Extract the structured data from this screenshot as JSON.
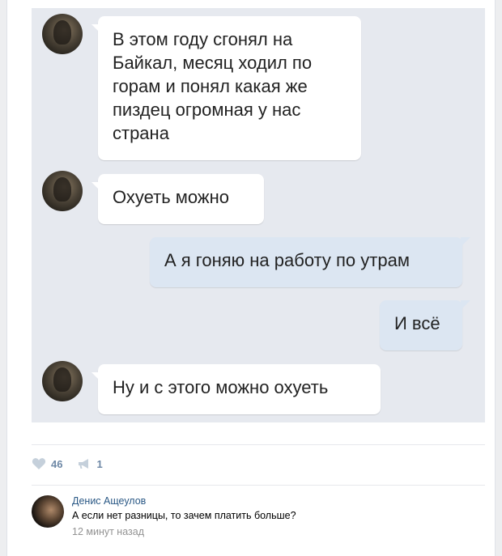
{
  "messages": [
    {
      "direction": "in",
      "text": "В этом году сгонял на Байкал, месяц ходил по горам и понял какая же пиздец огромная у нас страна"
    },
    {
      "direction": "in",
      "text": "Охуеть можно"
    },
    {
      "direction": "out",
      "text": "А я гоняю на работу по утрам"
    },
    {
      "direction": "out",
      "text": "И всё"
    },
    {
      "direction": "in",
      "text": "Ну и с этого можно охуеть"
    }
  ],
  "post_actions": {
    "likes": "46",
    "shares": "1"
  },
  "comment": {
    "author": "Денис Ащеулов",
    "text": "А если нет разницы, то зачем платить больше?",
    "time": "12 минут назад"
  },
  "colors": {
    "chat_background": "#e6e9ef",
    "incoming_bubble": "#ffffff",
    "outgoing_bubble": "#dce6f2",
    "action_text": "#6e88a6",
    "author_link": "#2a5885"
  },
  "icons": {
    "like": "heart-icon",
    "share": "megaphone-icon"
  }
}
